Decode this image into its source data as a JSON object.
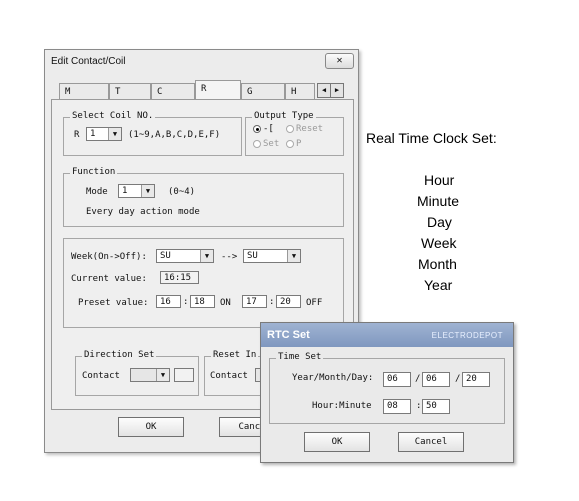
{
  "edit_dialog": {
    "title": "Edit Contact/Coil",
    "close_glyph": "✕",
    "tabs": [
      "M",
      "T",
      "C",
      "R",
      "G",
      "H"
    ],
    "selected_tab": "R",
    "tab_scroll": {
      "left": "◀",
      "right": "▶"
    },
    "select_coil": {
      "title": "Select Coil NO.",
      "prefix": "R",
      "value": "1",
      "range": "(1~9,A,B,C,D,E,F)"
    },
    "output_type": {
      "title": "Output Type",
      "options": [
        "-[",
        "Reset",
        "Set",
        "P"
      ],
      "selected": "-["
    },
    "function": {
      "title": "Function",
      "mode_label": "Mode",
      "mode_value": "1",
      "mode_range": "(0~4)",
      "description": "Every day action mode"
    },
    "week": {
      "label": "Week(On->Off):",
      "on_value": "SU",
      "arrow": "-->",
      "off_value": "SU"
    },
    "current_value": {
      "label": "Current value:",
      "value": "16:15"
    },
    "preset": {
      "label": "Preset value:",
      "on_hour": "16",
      "on_min": "18",
      "on_text": "ON",
      "off_hour": "17",
      "off_min": "20",
      "off_text": "OFF",
      "sep": ":"
    },
    "direction_set": {
      "title": "Direction Set",
      "contact_label": "Contact"
    },
    "reset_input": {
      "title": "Reset In",
      "contact_label": "Contact"
    },
    "buttons": {
      "ok": "OK",
      "cancel": "Cance"
    }
  },
  "side_text": {
    "heading": "Real Time Clock Set:",
    "items": [
      "Hour",
      "Minute",
      "Day",
      "Week",
      "Month",
      "Year"
    ]
  },
  "rtc_dialog": {
    "title": "RTC Set",
    "brand": "ELECTRODEPOT",
    "group_title": "Time Set",
    "date_label": "Year/Month/Day:",
    "year": "06",
    "month": "06",
    "day": "20",
    "date_sep": "/",
    "time_label": "Hour:Minute",
    "hour": "08",
    "minute": "50",
    "time_sep": ":",
    "ok": "OK",
    "cancel": "Cancel"
  }
}
